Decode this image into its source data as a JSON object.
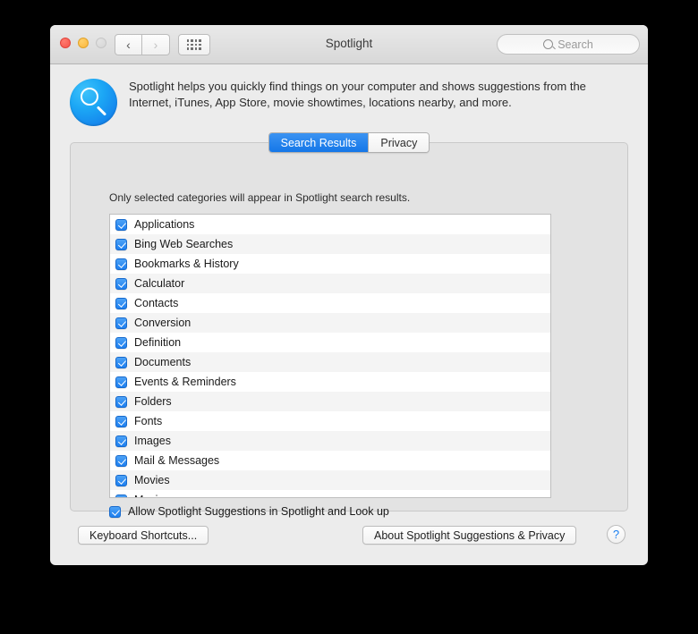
{
  "window": {
    "title": "Spotlight",
    "traffic_lights": [
      "close",
      "minimize",
      "zoom"
    ],
    "nav": {
      "back": "‹",
      "forward": "›"
    },
    "search": {
      "placeholder": "Search",
      "value": ""
    }
  },
  "banner": {
    "icon": "spotlight-search-icon",
    "description": "Spotlight helps you quickly find things on your computer and shows suggestions from the Internet, iTunes, App Store, movie showtimes, locations nearby, and more."
  },
  "tabs": [
    {
      "label": "Search Results",
      "active": true
    },
    {
      "label": "Privacy",
      "active": false
    }
  ],
  "panel": {
    "hint": "Only selected categories will appear in Spotlight search results.",
    "categories": [
      {
        "label": "Applications",
        "checked": true
      },
      {
        "label": "Bing Web Searches",
        "checked": true
      },
      {
        "label": "Bookmarks & History",
        "checked": true
      },
      {
        "label": "Calculator",
        "checked": true
      },
      {
        "label": "Contacts",
        "checked": true
      },
      {
        "label": "Conversion",
        "checked": true
      },
      {
        "label": "Definition",
        "checked": true
      },
      {
        "label": "Documents",
        "checked": true
      },
      {
        "label": "Events & Reminders",
        "checked": true
      },
      {
        "label": "Folders",
        "checked": true
      },
      {
        "label": "Fonts",
        "checked": true
      },
      {
        "label": "Images",
        "checked": true
      },
      {
        "label": "Mail & Messages",
        "checked": true
      },
      {
        "label": "Movies",
        "checked": true
      },
      {
        "label": "Music",
        "checked": true
      }
    ],
    "allow_suggestions": {
      "label": "Allow Spotlight Suggestions in Spotlight and Look up",
      "checked": true
    }
  },
  "footer": {
    "keyboard_shortcuts_label": "Keyboard Shortcuts...",
    "about_privacy_label": "About Spotlight Suggestions & Privacy",
    "help_label": "?"
  },
  "colors": {
    "accent_blue": "#1d7ff0",
    "tab_active": "#2f8bf0",
    "window_bg": "#ececec",
    "panel_bg": "#e3e3e3",
    "list_bg": "#ffffff",
    "list_stripe": "#f4f4f4"
  }
}
